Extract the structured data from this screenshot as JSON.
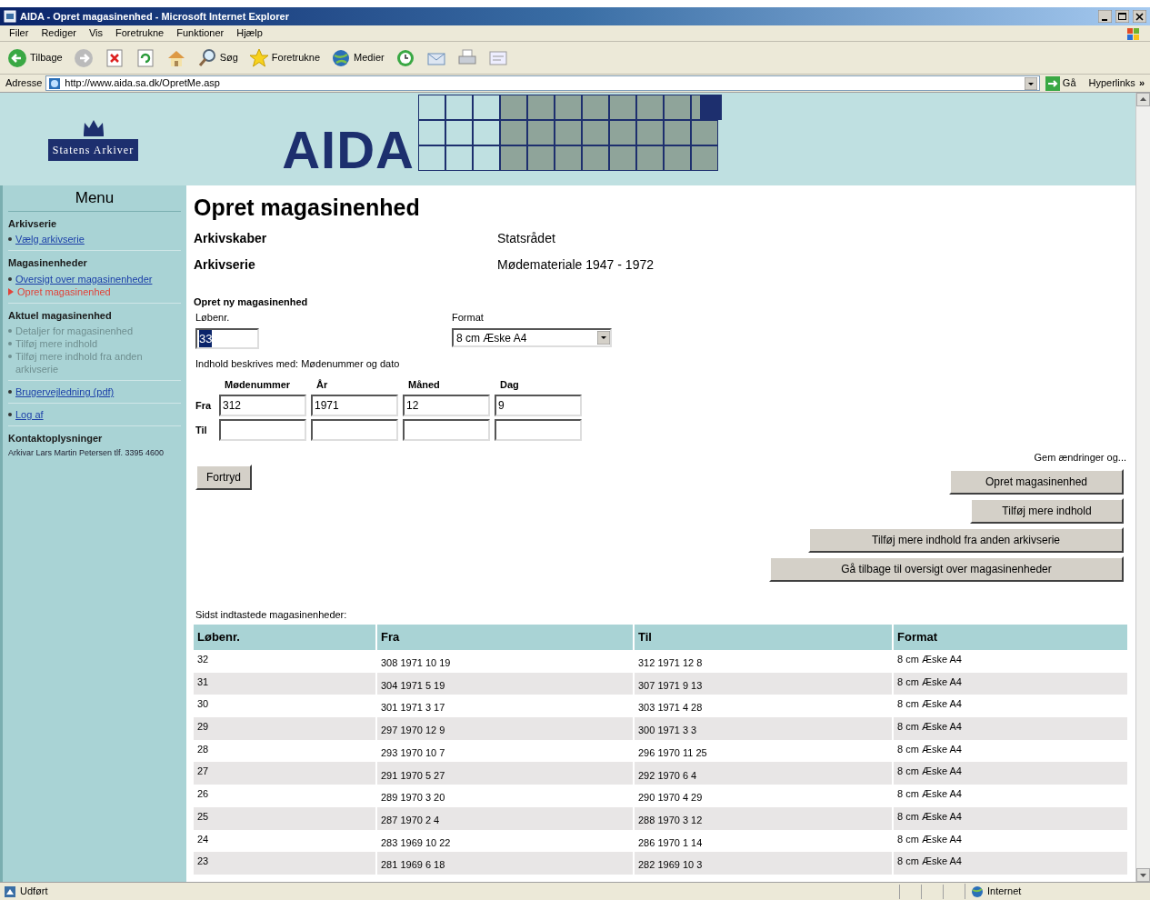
{
  "window": {
    "title": "AIDA - Opret magasinenhed - Microsoft Internet Explorer"
  },
  "menu_bar": [
    "Filer",
    "Rediger",
    "Vis",
    "Foretrukne",
    "Funktioner",
    "Hjælp"
  ],
  "toolbar": [
    {
      "kind": "back",
      "label": "Tilbage"
    },
    {
      "kind": "forward"
    },
    {
      "kind": "stop"
    },
    {
      "kind": "refresh"
    },
    {
      "kind": "home"
    },
    {
      "kind": "search",
      "label": "Søg"
    },
    {
      "kind": "favorites",
      "label": "Foretrukne"
    },
    {
      "kind": "media",
      "label": "Medier"
    },
    {
      "kind": "history"
    },
    {
      "kind": "mail"
    },
    {
      "kind": "print"
    },
    {
      "kind": "edit"
    }
  ],
  "address_bar": {
    "label": "Adresse",
    "url": "http://www.aida.sa.dk/OpretMe.asp",
    "go": "Gå",
    "links": "Hyperlinks",
    "more": "»"
  },
  "banner": {
    "logo_text": "Statens Arkiver",
    "title": "AIDA"
  },
  "sidebar": {
    "heading": "Menu",
    "sections": [
      {
        "title": "Arkivserie",
        "items": [
          {
            "label": "Vælg arkivserie",
            "kind": "link"
          }
        ]
      },
      {
        "title": "Magasinenheder",
        "items": [
          {
            "label": "Oversigt over magasinenheder",
            "kind": "link"
          },
          {
            "label": "Opret magasinenhed",
            "kind": "current"
          }
        ]
      },
      {
        "title": "Aktuel magasinenhed",
        "items": [
          {
            "label": "Detaljer for magasinenhed",
            "kind": "disabled"
          },
          {
            "label": "Tilføj mere indhold",
            "kind": "disabled"
          },
          {
            "label": "Tilføj mere indhold fra anden arkivserie",
            "kind": "disabled"
          }
        ]
      },
      {
        "items": [
          {
            "label": "Brugervejledning (pdf)",
            "kind": "link"
          }
        ]
      },
      {
        "items": [
          {
            "label": "Log af",
            "kind": "link"
          }
        ]
      },
      {
        "title": "Kontaktoplysninger",
        "text": "Arkivar Lars Martin Petersen tlf. 3395 4600"
      }
    ]
  },
  "main": {
    "title": "Opret magasinenhed",
    "info": [
      {
        "label": "Arkivskaber",
        "value": "Statsrådet"
      },
      {
        "label": "Arkivserie",
        "value": "Mødemateriale 1947 - 1972"
      }
    ],
    "form": {
      "heading": "Opret ny magasinenhed",
      "number": {
        "label": "Løbenr.",
        "value": "33",
        "text_selected": true
      },
      "format": {
        "label": "Format",
        "value": "8 cm Æske A4"
      },
      "description": "Indhold beskrives med: Mødenummer og dato",
      "columns": [
        "Mødenummer",
        "År",
        "Måned",
        "Dag"
      ],
      "rows": [
        {
          "label": "Fra",
          "values": [
            "312",
            "1971",
            "12",
            "9"
          ]
        },
        {
          "label": "Til"
        }
      ],
      "cancel": "Fortryd",
      "save_heading": "Gem ændringer og...",
      "actions": [
        "Opret magasinenhed",
        "Tilføj mere indhold",
        "Tilføj mere indhold fra anden arkivserie",
        "Gå tilbage til oversigt over magasinenheder"
      ]
    },
    "recent": {
      "caption": "Sidst indtastede magasinenheder:",
      "columns": [
        "Løbenr.",
        "Fra",
        "Til",
        "Format"
      ],
      "rows": [
        [
          "32",
          "308 1971 10 19",
          "312 1971 12 8",
          "8 cm Æske A4"
        ],
        [
          "31",
          "304 1971 5 19",
          "307 1971 9 13",
          "8 cm Æske A4"
        ],
        [
          "30",
          "301 1971 3 17",
          "303 1971 4 28",
          "8 cm Æske A4"
        ],
        [
          "29",
          "297 1970 12 9",
          "300 1971 3 3",
          "8 cm Æske A4"
        ],
        [
          "28",
          "293 1970 10 7",
          "296 1970 11 25",
          "8 cm Æske A4"
        ],
        [
          "27",
          "291 1970 5 27",
          "292 1970 6 4",
          "8 cm Æske A4"
        ],
        [
          "26",
          "289 1970 3 20",
          "290 1970 4 29",
          "8 cm Æske A4"
        ],
        [
          "25",
          "287 1970 2 4",
          "288 1970 3 12",
          "8 cm Æske A4"
        ],
        [
          "24",
          "283 1969 10 22",
          "286 1970 1 14",
          "8 cm Æske A4"
        ],
        [
          "23",
          "281 1969 6 18",
          "282 1969 10 3",
          "8 cm Æske A4"
        ]
      ]
    }
  },
  "status_bar": {
    "text": "Udført",
    "zone": "Internet"
  }
}
